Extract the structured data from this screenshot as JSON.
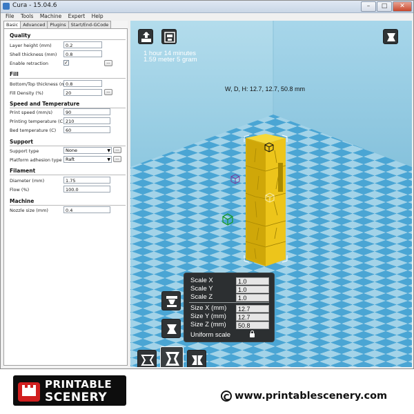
{
  "window": {
    "title": "Cura - 15.04.6",
    "controls": {
      "minimize": "–",
      "maximize": "□",
      "close": "✕"
    }
  },
  "menu": [
    "File",
    "Tools",
    "Machine",
    "Expert",
    "Help"
  ],
  "tabs": [
    "Basic",
    "Advanced",
    "Plugins",
    "Start/End-GCode"
  ],
  "active_tab": "Basic",
  "sections": {
    "quality": {
      "title": "Quality",
      "layer_height": {
        "label": "Layer height (mm)",
        "value": "0.2"
      },
      "shell_thickness": {
        "label": "Shell thickness (mm)",
        "value": "0.8"
      },
      "enable_retraction": {
        "label": "Enable retraction",
        "checked": "✓"
      }
    },
    "fill": {
      "title": "Fill",
      "bottom_top_thickness": {
        "label": "Bottom/Top thickness (mm)",
        "value": "0.8"
      },
      "fill_density": {
        "label": "Fill Density (%)",
        "value": "20"
      }
    },
    "speed": {
      "title": "Speed and Temperature",
      "print_speed": {
        "label": "Print speed (mm/s)",
        "value": "90"
      },
      "printing_temperature": {
        "label": "Printing temperature (C)",
        "value": "210"
      },
      "bed_temperature": {
        "label": "Bed temperature (C)",
        "value": "60"
      }
    },
    "support": {
      "title": "Support",
      "support_type": {
        "label": "Support type",
        "value": "None"
      },
      "platform_adhesion": {
        "label": "Platform adhesion type",
        "value": "Raft"
      }
    },
    "filament": {
      "title": "Filament",
      "diameter": {
        "label": "Diameter (mm)",
        "value": "1.75"
      },
      "flow": {
        "label": "Flow (%)",
        "value": "100.0"
      }
    },
    "machine": {
      "title": "Machine",
      "nozzle_size": {
        "label": "Nozzle size (mm)",
        "value": "0.4"
      }
    }
  },
  "buttons": {
    "more": "..."
  },
  "viewport": {
    "print_time": "1 hour 14 minutes",
    "filament_used": "1.59 meter 5 gram",
    "dimensions": "W, D, H: 12.7, 12.7, 50.8 mm",
    "model_color": "#e8c21a",
    "grid_colors": {
      "light": "#9bcfe6",
      "dark": "#4aa6d6"
    }
  },
  "scale_panel": {
    "scale_x": {
      "label": "Scale X",
      "value": "1.0"
    },
    "scale_y": {
      "label": "Scale Y",
      "value": "1.0"
    },
    "scale_z": {
      "label": "Scale Z",
      "value": "1.0"
    },
    "size_x": {
      "label": "Size X (mm)",
      "value": "12.7"
    },
    "size_y": {
      "label": "Size Y (mm)",
      "value": "12.7"
    },
    "size_z": {
      "label": "Size Z (mm)",
      "value": "50.8"
    },
    "uniform": {
      "label": "Uniform scale"
    }
  },
  "watermark": {
    "logo_line1": "PRINTABLE",
    "logo_line2": "SCENERY",
    "copyright_symbol": "C",
    "url": "www.printablescenery.com"
  }
}
